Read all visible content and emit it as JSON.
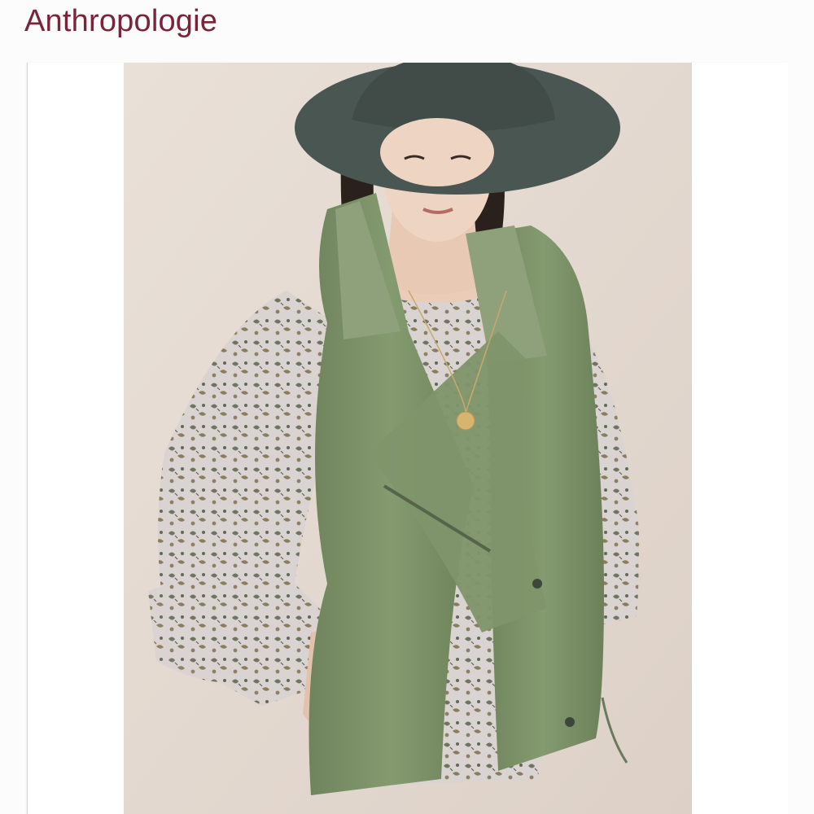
{
  "header": {
    "brand": "Anthropologie"
  },
  "product": {
    "image_icon": "product-photo",
    "image_subject": "model-in-olive-moto-vest",
    "colors": {
      "brand": "#7a2339",
      "background": "#e6dcd4",
      "vest": "#7b8f66",
      "hat": "#4b5753",
      "blouse": "#cfc8c6"
    }
  }
}
